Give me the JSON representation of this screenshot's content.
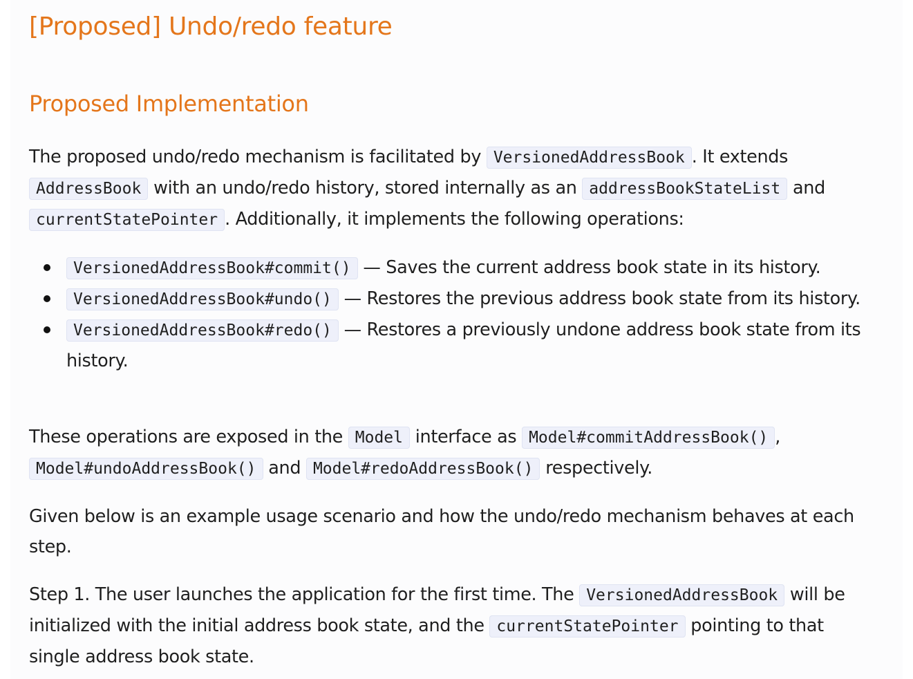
{
  "heading": "[Proposed] Undo/redo feature",
  "subheading": "Proposed Implementation",
  "para1": {
    "t1": "The proposed undo/redo mechanism is facilitated by ",
    "c1": "VersionedAddressBook",
    "t2": ". It extends ",
    "c2": "AddressBook",
    "t3": " with an undo/redo history, stored internally as an ",
    "c3": "addressBookStateList",
    "t4": " and ",
    "c4": "currentStatePointer",
    "t5": ". Additionally, it implements the following operations:"
  },
  "operations": [
    {
      "code": "VersionedAddressBook#commit()",
      "desc": " — Saves the current address book state in its history."
    },
    {
      "code": "VersionedAddressBook#undo()",
      "desc": " — Restores the previous address book state from its history."
    },
    {
      "code": "VersionedAddressBook#redo()",
      "desc": " — Restores a previously undone address book state from its history."
    }
  ],
  "para2": {
    "t1": "These operations are exposed in the ",
    "c1": "Model",
    "t2": " interface as ",
    "c2": "Model#commitAddressBook()",
    "t3": ", ",
    "c3": "Model#undoAddressBook()",
    "t4": " and ",
    "c4": "Model#redoAddressBook()",
    "t5": " respectively."
  },
  "para3": "Given below is an example usage scenario and how the undo/redo mechanism behaves at each step.",
  "para4": {
    "t1": "Step 1. The user launches the application for the first time. The ",
    "c1": "VersionedAddressBook",
    "t2": " will be initialized with the initial address book state, and the ",
    "c2": "currentStatePointer",
    "t3": " pointing to that single address book state."
  }
}
